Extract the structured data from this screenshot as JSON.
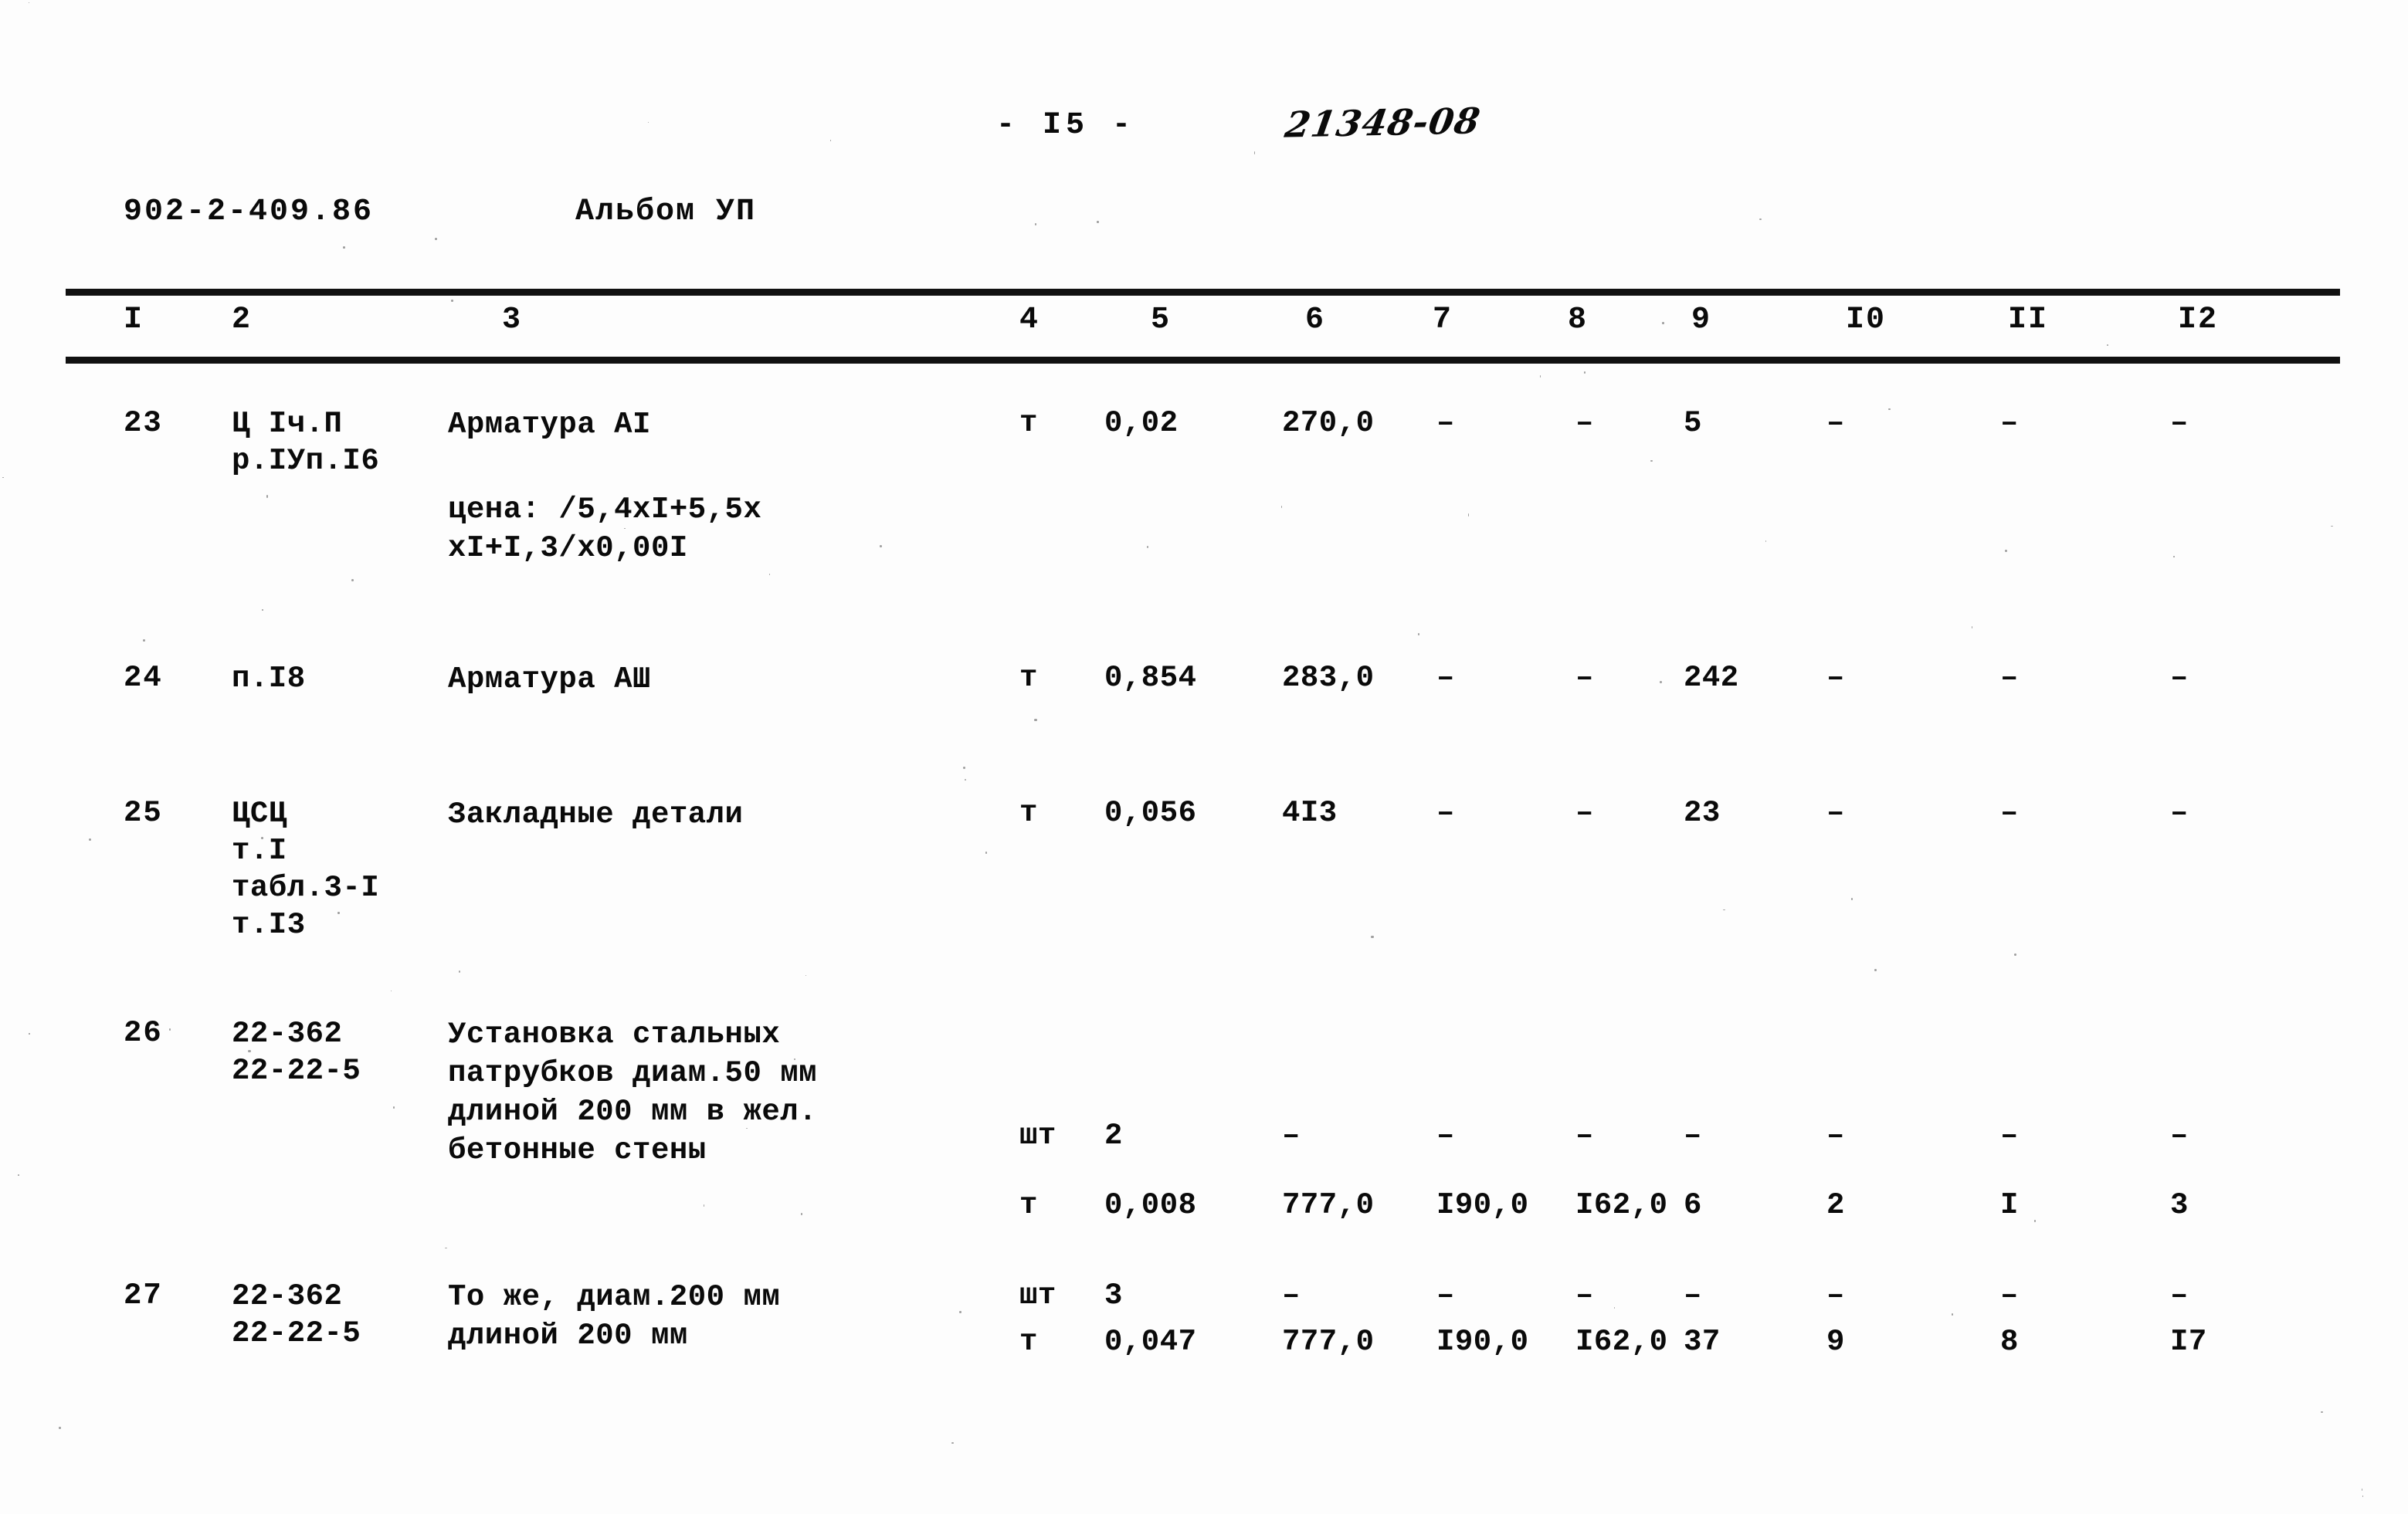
{
  "header": {
    "page_number": "- I5 -",
    "handwritten_code": "21348-08",
    "album_code": "902-2-409.86",
    "album_name": "Альбом УП"
  },
  "table": {
    "column_headers": [
      "I",
      "2",
      "3",
      "4",
      "5",
      "6",
      "7",
      "8",
      "9",
      "I0",
      "II",
      "I2"
    ],
    "rows": [
      {
        "index": "23",
        "code": "Ц Iч.П\nр.IУп.I6",
        "description": "Арматура АI",
        "description_extra": "цена: /5,4хI+5,5х\nхI+I,3/х0,00I",
        "lines": [
          {
            "unit": "т",
            "c5": "0,02",
            "c6": "270,0",
            "c7": "–",
            "c8": "–",
            "c9": "5",
            "c10": "–",
            "c11": "–",
            "c12": "–"
          }
        ]
      },
      {
        "index": "24",
        "code": "п.I8",
        "description": "Арматура АШ",
        "description_extra": "",
        "lines": [
          {
            "unit": "т",
            "c5": "0,854",
            "c6": "283,0",
            "c7": "–",
            "c8": "–",
            "c9": "242",
            "c10": "–",
            "c11": "–",
            "c12": "–"
          }
        ]
      },
      {
        "index": "25",
        "code": "ЦСЦ\nт.I\nтабл.3-I\nт.I3",
        "description": "Закладные детали",
        "description_extra": "",
        "lines": [
          {
            "unit": "т",
            "c5": "0,056",
            "c6": "4I3",
            "c7": "–",
            "c8": "–",
            "c9": "23",
            "c10": "–",
            "c11": "–",
            "c12": "–"
          }
        ]
      },
      {
        "index": "26",
        "code": "22-362\n22-22-5",
        "description": "Установка стальных\nпатрубков диам.50 мм\nдлиной 200 мм в жел.\nбетонные стены",
        "description_extra": "",
        "lines": [
          {
            "unit": "шт",
            "c5": "2",
            "c6": "–",
            "c7": "–",
            "c8": "–",
            "c9": "–",
            "c10": "–",
            "c11": "–",
            "c12": "–"
          },
          {
            "unit": "т",
            "c5": "0,008",
            "c6": "777,0",
            "c7": "I90,0",
            "c8": "I62,0",
            "c9": "6",
            "c10": "2",
            "c11": "I",
            "c12": "3"
          }
        ]
      },
      {
        "index": "27",
        "code": "22-362\n22-22-5",
        "description": "То же, диам.200 мм\nдлиной 200 мм",
        "description_extra": "",
        "lines": [
          {
            "unit": "шт",
            "c5": "3",
            "c6": "–",
            "c7": "–",
            "c8": "–",
            "c9": "–",
            "c10": "–",
            "c11": "–",
            "c12": "–"
          },
          {
            "unit": "т",
            "c5": "0,047",
            "c6": "777,0",
            "c7": "I90,0",
            "c8": "I62,0",
            "c9": "37",
            "c10": "9",
            "c11": "8",
            "c12": "I7"
          }
        ]
      }
    ]
  }
}
